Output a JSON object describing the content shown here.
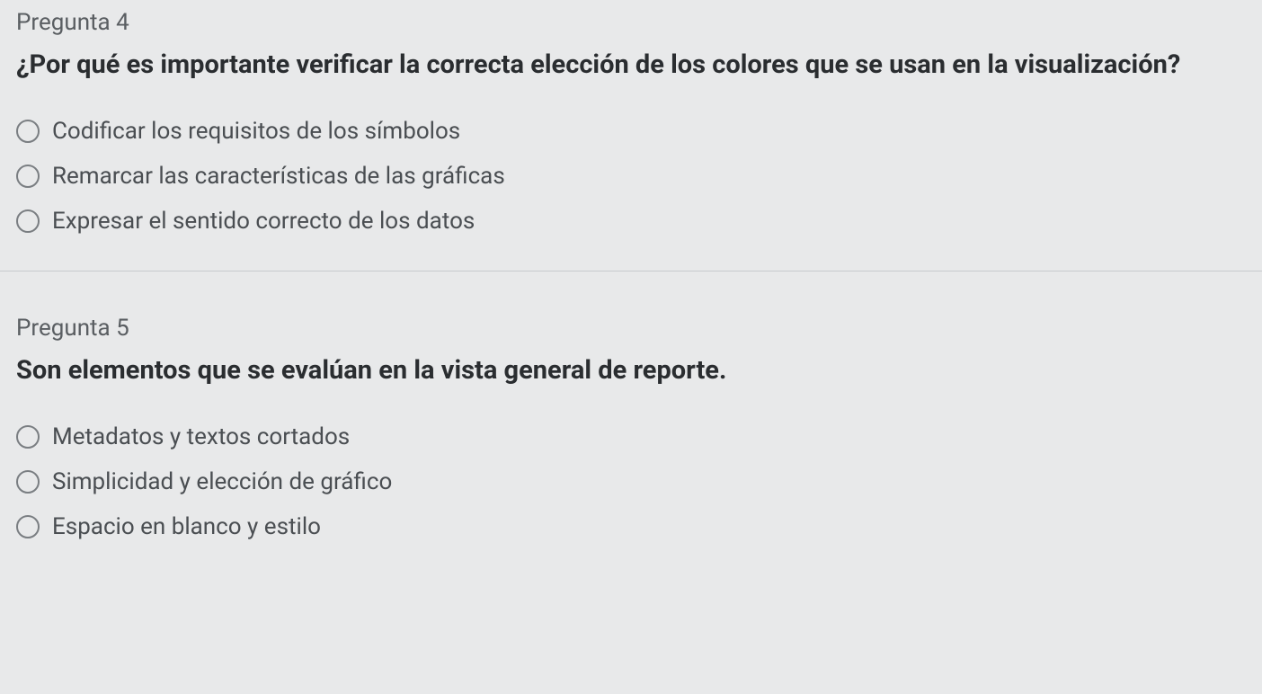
{
  "questions": [
    {
      "label": "Pregunta 4",
      "text": "¿Por qué es importante verificar la correcta elección de los colores que se usan en la visualización?",
      "options": [
        "Codificar los requisitos de los símbolos",
        "Remarcar las características de las gráficas",
        "Expresar el sentido correcto de los datos"
      ]
    },
    {
      "label": "Pregunta 5",
      "text": "Son elementos que se evalúan en la vista general de reporte.",
      "options": [
        "Metadatos y textos cortados",
        "Simplicidad y elección de gráfico",
        "Espacio en blanco y estilo"
      ]
    }
  ]
}
